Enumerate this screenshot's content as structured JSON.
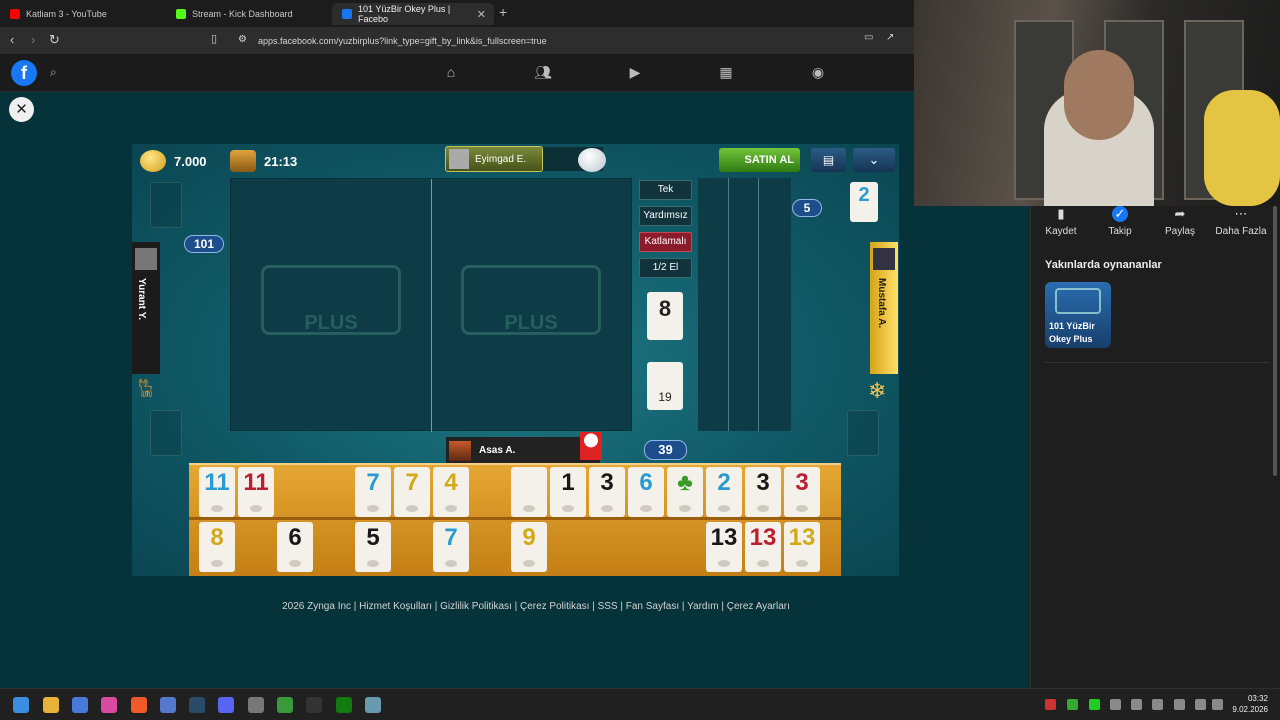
{
  "browser": {
    "tabs": [
      {
        "label": "Katliam 3 - YouTube",
        "active": false,
        "color": "#ff0000"
      },
      {
        "label": "Stream - Kick Dashboard",
        "active": false,
        "color": "#53fc18"
      },
      {
        "label": "101 YüzBir Okey Plus | Facebo",
        "active": true,
        "color": "#1877f2"
      }
    ],
    "url": "apps.facebook.com/yuzbirplus?link_type=gift_by_link&is_fullscreen=true"
  },
  "fb_nav_icons": [
    "home-icon",
    "friends-icon",
    "video-icon",
    "marketplace-icon",
    "groups-icon"
  ],
  "game": {
    "coins": "7.000",
    "time": "21:13",
    "top_player": "Eyimgad E.",
    "buy_label": "SATIN AL",
    "left_player": "Yurant Y.",
    "right_player": "Mustafa A.",
    "bottom_player": "Asas A.",
    "score_left": "101",
    "score_right": "5",
    "deck_count": "39",
    "modes": [
      "Tek",
      "Yardımsız",
      "Katlamalı",
      "1/2 El"
    ],
    "indicator_tile": "8",
    "discard_count": "19",
    "right_tile": "2",
    "board_logo": "PLUS"
  },
  "rack": {
    "top_row": [
      {
        "v": "11",
        "c": "blue"
      },
      {
        "v": "11",
        "c": "red"
      },
      null,
      null,
      {
        "v": "7",
        "c": "blue"
      },
      {
        "v": "7",
        "c": "yellow"
      },
      {
        "v": "4",
        "c": "yellow"
      },
      null,
      {
        "v": "",
        "c": "black"
      },
      {
        "v": "1",
        "c": "black"
      },
      {
        "v": "3",
        "c": "black"
      },
      {
        "v": "6",
        "c": "blue"
      },
      {
        "v": "♣",
        "c": "green"
      },
      {
        "v": "2",
        "c": "blue"
      },
      {
        "v": "3",
        "c": "black"
      },
      {
        "v": "3",
        "c": "red"
      }
    ],
    "bottom_row": [
      {
        "v": "8",
        "c": "yellow"
      },
      null,
      {
        "v": "6",
        "c": "black"
      },
      null,
      {
        "v": "5",
        "c": "black"
      },
      null,
      {
        "v": "7",
        "c": "blue"
      },
      null,
      {
        "v": "9",
        "c": "yellow"
      },
      null,
      null,
      null,
      null,
      {
        "v": "13",
        "c": "black"
      },
      {
        "v": "13",
        "c": "red"
      },
      {
        "v": "13",
        "c": "yellow"
      }
    ]
  },
  "footer": "2026 Zynga Inc | Hizmet Koşulları | Gizlilik Politikası | Çerez Politikası | SSS | Fan Sayfası | Yardım | Çerez Ayarları",
  "right_panel": {
    "actions": [
      {
        "label": "Kaydet",
        "icon": "bookmark-icon"
      },
      {
        "label": "Takip",
        "icon": "follow-icon"
      },
      {
        "label": "Paylaş",
        "icon": "share-icon"
      },
      {
        "label": "Daha Fazla",
        "icon": "more-icon"
      }
    ],
    "recent_title": "Yakınlarda oynananlar",
    "recent_game": "101 YüzBir Okey Plus"
  },
  "taskbar": {
    "time": "03:32",
    "date": "9.02.2026"
  }
}
